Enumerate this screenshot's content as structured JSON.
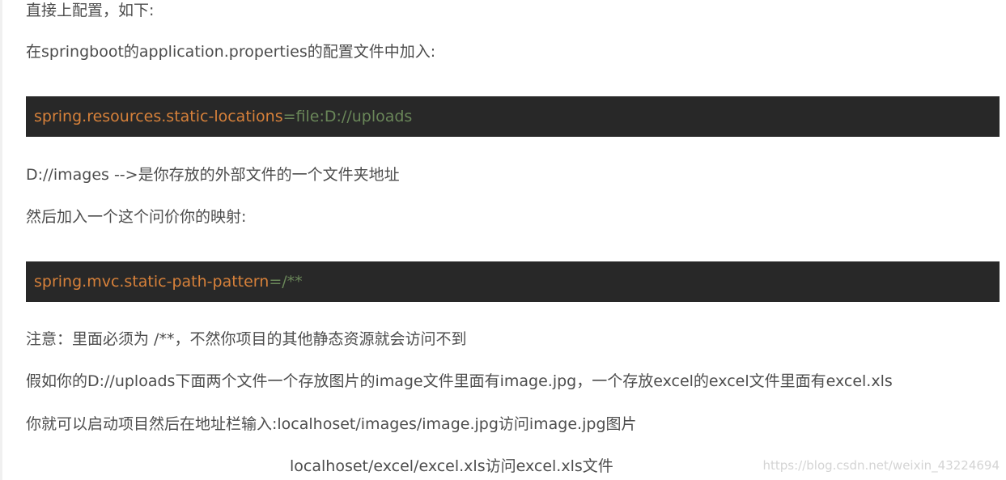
{
  "paragraphs": {
    "p1": "直接上配置，如下:",
    "p2": "在springboot的application.properties的配置文件中加入:",
    "p3": "D://images   -->是你存放的外部文件的一个文件夹地址",
    "p4": "然后加入一个这个问价你的映射:",
    "p5": "注意：里面必须为   /**，不然你项目的其他静态资源就会访问不到",
    "p6": "假如你的D://uploads下面两个文件一个存放图片的image文件里面有image.jpg，一个存放excel的excel文件里面有excel.xls",
    "p7": "你就可以启动项目然后在地址栏输入:localhoset/images/image.jpg访问image.jpg图片",
    "p8": "localhoset/excel/excel.xls访问excel.xls文件"
  },
  "code1": {
    "key": "spring.resources.static-locations",
    "eq": "=",
    "value": "file:D://uploads"
  },
  "code2": {
    "key": "spring.mvc.static-path-pattern",
    "eq": "=",
    "value": "/**"
  },
  "watermark": "https://blog.csdn.net/weixin_43224694",
  "colors": {
    "text": "#4d4d4d",
    "code_background": "#282828",
    "code_key": "#d7813a",
    "code_value": "#6a8759",
    "watermark": "#d4d4d4"
  }
}
